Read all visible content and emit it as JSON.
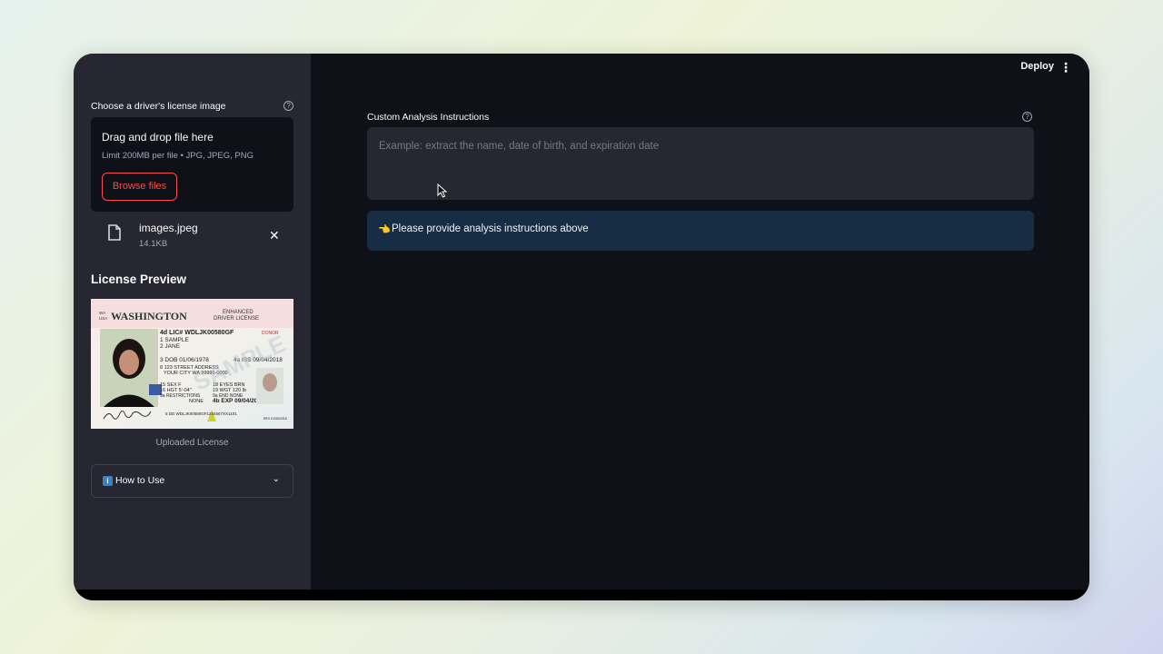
{
  "header": {
    "deploy_label": "Deploy",
    "menu_icon": "more-vertical-icon"
  },
  "sidebar": {
    "uploader_label": "Choose a driver's license image",
    "dropzone_title": "Drag and drop file here",
    "dropzone_limit": "Limit 200MB per file • JPG, JPEG, PNG",
    "browse_label": "Browse files",
    "file": {
      "name": "images.jpeg",
      "size": "14.1KB"
    },
    "preview_title": "License Preview",
    "preview_caption": "Uploaded License",
    "license_card": {
      "state_code": "WA",
      "country": "USA",
      "state": "WASHINGTON",
      "type_line1": "ENHANCED",
      "type_line2": "DRIVER LICENSE",
      "lic_no": "4d LIC# WDLJK00580GF",
      "donor": "DONOR",
      "last_name": "1 SAMPLE",
      "first_name": "2 JANE",
      "dob": "3 DOB 01/06/1978",
      "iss": "4a ISS 09/04/2018",
      "address1": "8 123 STREET ADDRESS",
      "address2": "YOUR CITY WA 99999-0000",
      "sex": "15 SEX F",
      "eyes": "18 EYES BRN",
      "height": "16 HGT 5'-04\"",
      "weight": "19 WGT 120 lb",
      "restrictions": "9a RESTRICTIONS",
      "endorsements": "9a END NONE",
      "restrictions_value": "NONE",
      "exp": "4b EXP 09/04/2024",
      "dd": "5 DD WDLJK00580GF1234567XX1101",
      "rev": "REV 01/06/2018",
      "watermark": "SAMPLE"
    },
    "expander_icon": "info-icon",
    "expander_label": "How to Use"
  },
  "main": {
    "textarea_label": "Custom Analysis Instructions",
    "textarea_value": "",
    "textarea_placeholder": "Example: extract the name, date of birth, and expiration date",
    "info_emoji": "👈",
    "info_text": "Please provide analysis instructions above"
  },
  "colors": {
    "accent": "#ff4b4b",
    "sidebar_bg": "#262730",
    "main_bg": "#0e1117",
    "info_bg": "#172d43"
  }
}
